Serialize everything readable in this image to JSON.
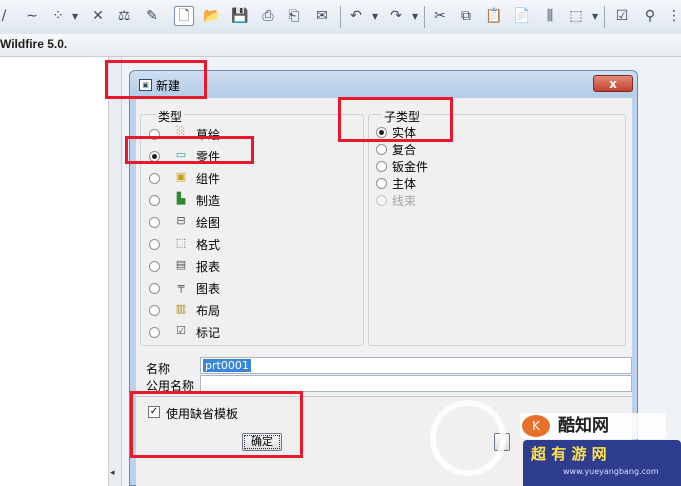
{
  "app": {
    "title": "Wildfire 5.0."
  },
  "toolbar": {
    "icons": [
      "slash-icon",
      "curve-icon",
      "points-icon",
      "dropdown",
      "trim-icon",
      "datum-icon",
      "pencil-icon",
      "new-file-icon",
      "open-folder-icon",
      "save-icon",
      "print-icon",
      "print-preview-icon",
      "send-icon",
      "undo-icon",
      "redo-icon",
      "cut-icon",
      "copy-icon",
      "paste-icon",
      "paste-special-icon",
      "align-icon",
      "select-box-icon",
      "regen-icon",
      "tree-icon"
    ]
  },
  "dialog": {
    "title": "新建",
    "close_glyph": "x",
    "type_group": {
      "label": "类型",
      "items": [
        {
          "label": "草绘",
          "icon": "sketch-icon",
          "checked": false
        },
        {
          "label": "零件",
          "icon": "part-icon",
          "checked": true
        },
        {
          "label": "组件",
          "icon": "assembly-icon",
          "checked": false
        },
        {
          "label": "制造",
          "icon": "manufacturing-icon",
          "checked": false
        },
        {
          "label": "绘图",
          "icon": "drawing-icon",
          "checked": false
        },
        {
          "label": "格式",
          "icon": "format-icon",
          "checked": false
        },
        {
          "label": "报表",
          "icon": "report-icon",
          "checked": false
        },
        {
          "label": "图表",
          "icon": "diagram-icon",
          "checked": false
        },
        {
          "label": "布局",
          "icon": "layout-icon",
          "checked": false
        },
        {
          "label": "标记",
          "icon": "markup-icon",
          "checked": false
        }
      ]
    },
    "subtype_group": {
      "label": "子类型",
      "items": [
        {
          "label": "实体",
          "checked": true,
          "disabled": false
        },
        {
          "label": "复合",
          "checked": false,
          "disabled": false
        },
        {
          "label": "钣金件",
          "checked": false,
          "disabled": false
        },
        {
          "label": "主体",
          "checked": false,
          "disabled": false
        },
        {
          "label": "线束",
          "checked": false,
          "disabled": true
        }
      ]
    },
    "name_label": "名称",
    "name_value": "prt0001",
    "common_name_label": "公用名称",
    "common_name_value": "",
    "default_template_label": "使用缺省模板",
    "default_template_checked": true,
    "ok_label": "确定"
  },
  "watermark": {
    "brand": "酷知网",
    "logo": "K",
    "badge_title": "超 有 游 网",
    "badge_url": "www.yueyangbang.com"
  },
  "colors": {
    "highlight": "#e8182d",
    "dialog_frame": "#bcd2ea",
    "selection": "#3a86d9"
  }
}
